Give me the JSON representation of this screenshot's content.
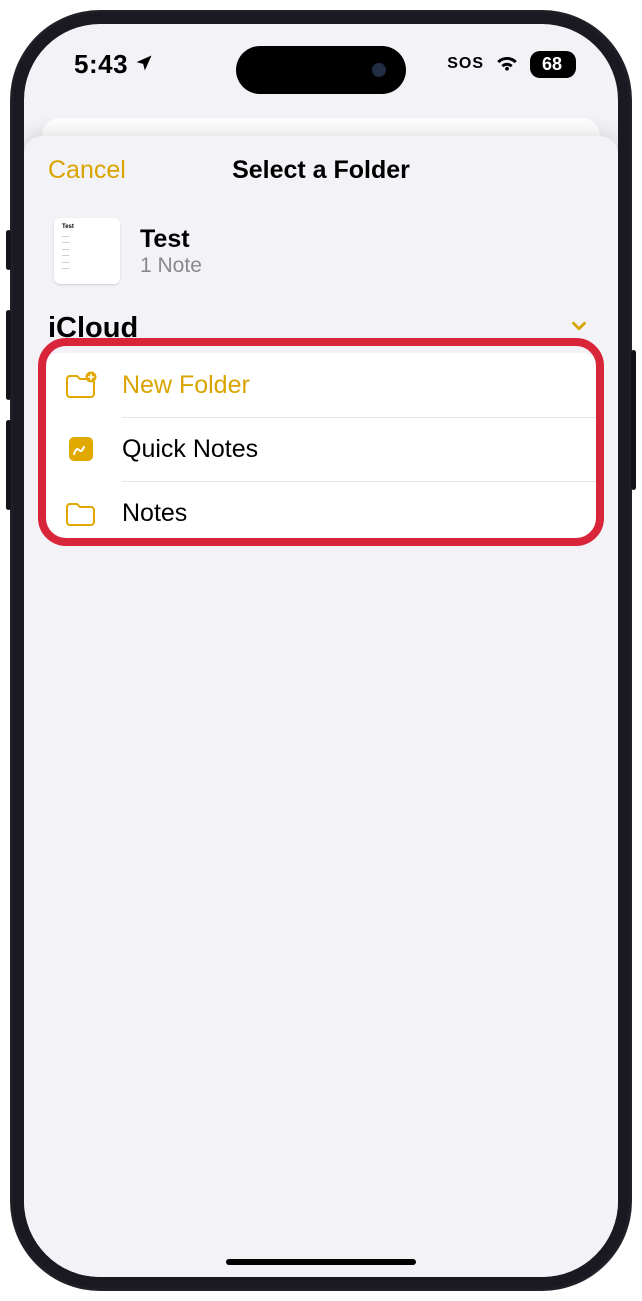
{
  "status": {
    "time": "5:43",
    "sos": "SOS",
    "battery": "68"
  },
  "modal": {
    "cancel": "Cancel",
    "title": "Select a Folder",
    "item": {
      "name": "Test",
      "subtitle": "1 Note"
    },
    "section": {
      "label": "iCloud"
    },
    "folders": [
      {
        "label": "New Folder",
        "kind": "new"
      },
      {
        "label": "Quick Notes",
        "kind": "quick"
      },
      {
        "label": "Notes",
        "kind": "folder"
      }
    ]
  }
}
